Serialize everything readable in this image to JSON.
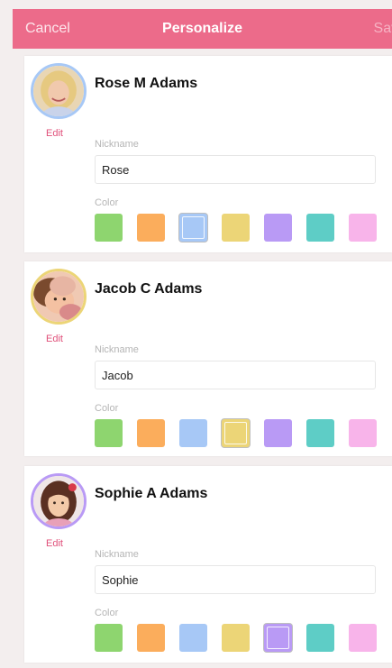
{
  "nav": {
    "cancel_label": "Cancel",
    "title": "Personalize",
    "save_label": "Save"
  },
  "palette": [
    "#8ed56f",
    "#fbad5c",
    "#a7c8f6",
    "#ecd577",
    "#b99af5",
    "#5ecdc6",
    "#f8b4ea"
  ],
  "people": [
    {
      "name": "Rose M Adams",
      "edit_label": "Edit",
      "nickname_label": "Nickname",
      "nickname": "Rose",
      "color_label": "Color",
      "ring_color": "#a7c8f6",
      "selected_color_index": 2
    },
    {
      "name": "Jacob C Adams",
      "edit_label": "Edit",
      "nickname_label": "Nickname",
      "nickname": "Jacob",
      "color_label": "Color",
      "ring_color": "#ecd577",
      "selected_color_index": 3
    },
    {
      "name": "Sophie A Adams",
      "edit_label": "Edit",
      "nickname_label": "Nickname",
      "nickname": "Sophie",
      "color_label": "Color",
      "ring_color": "#b99af5",
      "selected_color_index": 4
    }
  ]
}
